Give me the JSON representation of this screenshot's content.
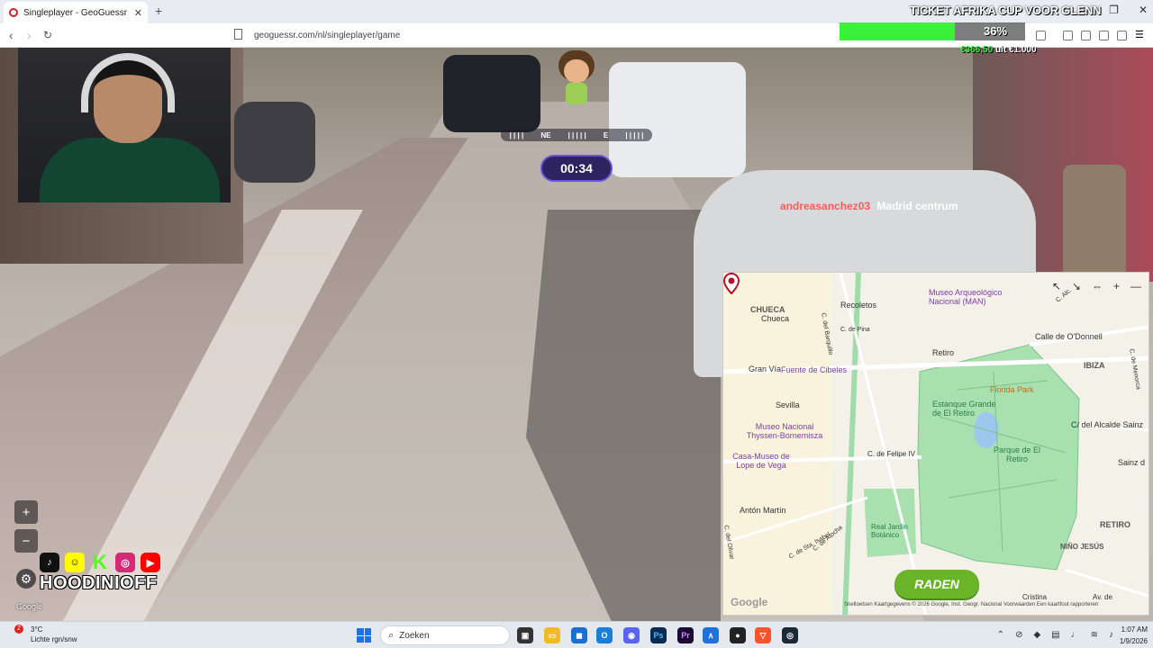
{
  "browser": {
    "tab_title": "Singleplayer - GeoGuessr",
    "new_tab": "+",
    "url": "geoguessr.com/nl/singleplayer/game",
    "window_controls": [
      "—",
      "❐",
      "✕"
    ]
  },
  "stream": {
    "goal_title": "TICKET AFRIKA CUP VOOR GLENN",
    "goal_percent": "36%",
    "goal_fraction": 0.62,
    "goal_current": "€366,50",
    "goal_target": "uit €1.000",
    "chat_user": "andreasanchez03",
    "chat_message": "Madrid centrum",
    "handle": "HOODINIOFF",
    "social_icons": [
      "tiktok-icon",
      "snapchat-icon",
      "kick-icon",
      "instagram-icon",
      "youtube-icon"
    ]
  },
  "game": {
    "timer": "00:34",
    "compass": [
      "NE",
      "E"
    ],
    "zoom_in": "+",
    "zoom_out": "−",
    "settings_icon": "gear-icon",
    "google_watermark": "Google"
  },
  "map": {
    "guess_button": "RADEN",
    "google_logo": "Google",
    "footer": "Sneltoetsen   Kaartgegevens © 2026 Google, Inst. Geogr. Nacional   Voorwaarden   Een kaartfout rapporteren",
    "controls": [
      "↖",
      "↘",
      "⇔",
      "+",
      "—"
    ],
    "labels": {
      "chueca_caps": "CHUECA",
      "chueca": "Chueca",
      "recoletos": "Recoletos",
      "museo_arq": "Museo Arqueológico Nacional (MAN)",
      "calle_odonnell": "Calle de O'Donnell",
      "retiro_small": "Retiro",
      "c_pina": "C. de Pina",
      "gran_via": "Gran Vía",
      "fuente_cibeles": "Fuente de Cibeles",
      "ibiza": "IBIZA",
      "florida_park": "Florida Park",
      "estanque": "Estanque Grande de El Retiro",
      "sevilla": "Sevilla",
      "alcalde_sainz": "C/ del Alcalde Sainz",
      "thyssen": "Museo Nacional Thyssen-Bornemisza",
      "parque_retiro": "Parque de El Retiro",
      "felipe": "C. de Felipe IV",
      "casa_museo": "Casa-Museo de Lope de Vega",
      "sainz_d": "Sainz d",
      "anton_martin": "Antón Martín",
      "retiro_caps": "RETIRO",
      "nino_jesus": "NIÑO JESÚS",
      "c_atocha": "C. de Atocha",
      "c_santa_isabel": "C. de Sta. Isabel",
      "real_jardin": "Real Jardín Botánico",
      "c_olivar": "C. del Olivar",
      "c_barquillo": "C. del Barquillo",
      "c_alcala": "C. Alc.",
      "c_menorca": "C. de Menorca",
      "ave_del": "Av. de",
      "iso": "lso",
      "cristina": "Cristina"
    }
  },
  "taskbar": {
    "temperature": "3°C",
    "weather": "Lichte rgn/snw",
    "weather_badge": "2",
    "search_placeholder": "Zoeken",
    "time": "1:07 AM",
    "date": "1/9/2026"
  }
}
